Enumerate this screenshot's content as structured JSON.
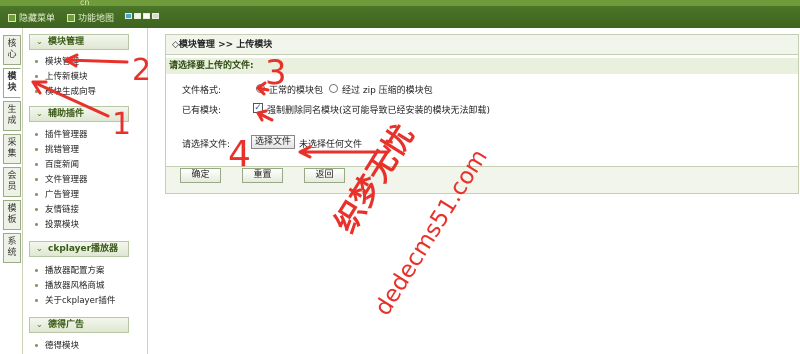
{
  "topbar": {
    "brand": "cn",
    "hide_menu": "隐藏菜单",
    "site_map": "功能地图",
    "swatches": [
      "#3fa9d9",
      "#f2f2f2",
      "#ffffff",
      "#d8d8d8"
    ]
  },
  "vtabs": [
    {
      "label": "核心"
    },
    {
      "label": "模块"
    },
    {
      "label": "生成"
    },
    {
      "label": "采集"
    },
    {
      "label": "会员"
    },
    {
      "label": "模板"
    },
    {
      "label": "系统"
    }
  ],
  "menu": {
    "groups": [
      {
        "title": "模块管理",
        "items": [
          "模块管理",
          "上传新模块",
          "模块生成向导"
        ]
      },
      {
        "title": "辅助插件",
        "items": [
          "插件管理器",
          "挑错管理",
          "百度新闻",
          "文件管理器",
          "广告管理",
          "友情链接",
          "投票模块"
        ]
      },
      {
        "title": "ckplayer播放器",
        "items": [
          "播放器配置方案",
          "播放器风格商城",
          "关于ckplayer插件"
        ]
      },
      {
        "title": "德得广告",
        "items": [
          "德得模块"
        ]
      }
    ]
  },
  "main": {
    "breadcrumb_prefix": "◇模块管理",
    "breadcrumb_sep": ">>",
    "breadcrumb_current": "上传模块",
    "section_title": "请选择要上传的文件:",
    "format_label": "文件格式:",
    "format_option_normal": "正常的模块包",
    "format_option_zip": "经过 zip 压缩的模块包",
    "existing_label": "已有模块:",
    "force_delete_text": "强制删除同名模块(这可能导致已经安装的模块无法卸载)",
    "choose_file_label": "请选择文件:",
    "choose_file_button": "选择文件",
    "no_file_text": "未选择任何文件",
    "confirm_button": "确定",
    "reset_button": "重置",
    "back_button": "返回"
  },
  "annotations": {
    "marks": [
      "1",
      "2",
      "3",
      "4"
    ],
    "watermark_a": "织梦无忧",
    "watermark_b": "dedecms51.com",
    "color": "#e8312a"
  }
}
